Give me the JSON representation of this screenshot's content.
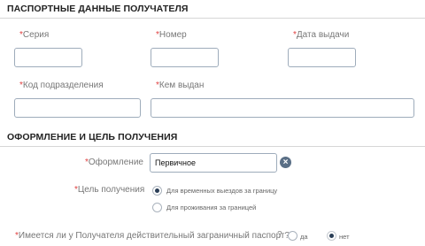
{
  "passport": {
    "title": "ПАСПОРТНЫЕ ДАННЫЕ ПОЛУЧАТЕЛЯ",
    "series_label": "Серия",
    "number_label": "Номер",
    "issue_date_label": "Дата выдачи",
    "division_code_label": "Код подразделения",
    "issued_by_label": "Кем выдан",
    "required_mark": "*"
  },
  "registration": {
    "title": "ОФОРМЛЕНИЕ И ЦЕЛЬ ПОЛУЧЕНИЯ",
    "type_label": "Оформление",
    "type_value": "Первичное",
    "clear_glyph": "×",
    "purpose_label": "Цель получения",
    "purpose_options": [
      {
        "label": "Для временных выездов за границу",
        "selected": true
      },
      {
        "label": "Для проживания за границей",
        "selected": false
      }
    ],
    "has_passport_question": "Имеется ли у Получателя действительный заграничный паспорт?",
    "question_icon": "?",
    "yes_label": "да",
    "no_label": "нет",
    "selected_answer": "нет"
  },
  "colors": {
    "required": "#e04040",
    "input_border": "#9eacbb",
    "clear_button": "#5a6f86",
    "radio_selected": "#2a3e56"
  }
}
